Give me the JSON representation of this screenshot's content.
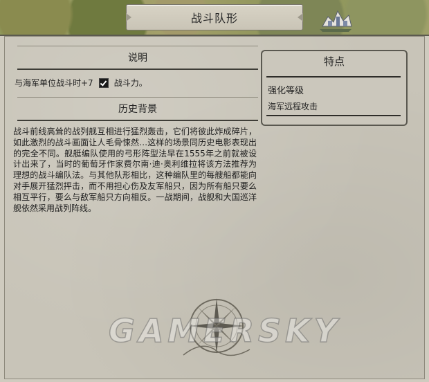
{
  "header": {
    "title": "战斗队形"
  },
  "description": {
    "heading": "说明",
    "effect_prefix": "与海军单位战斗时+7",
    "effect_suffix": "战斗力。"
  },
  "history": {
    "heading": "历史背景",
    "text": "战斗前线高耸的战列舰互相进行猛烈轰击，它们将彼此炸成碎片，如此激烈的战斗画面让人毛骨悚然…这样的场景同历史电影表现出的完全不同。舰艇编队使用的弓形阵型法早在1555年之前就被设计出来了，当时的葡萄牙作家费尔南·迪·奥利维拉将该方法推荐为理想的战斗编队法。与其他队形相比，这种编队里的每艘船都能向对手展开猛烈抨击，而不用担心伤及友军船只，因为所有船只要么相互平行，要么与敌军船只方向相反。一战期间，战舰和大国巡洋舰依然采用战列阵线。"
  },
  "features": {
    "heading": "特点",
    "subheading": "强化等级",
    "item": "海军远程攻击"
  },
  "watermark": {
    "text": "GAMERSKY"
  },
  "icons": {
    "combat_strength": "combat-strength-icon",
    "compass": "compass-rose-icon",
    "city": "city-icon"
  }
}
